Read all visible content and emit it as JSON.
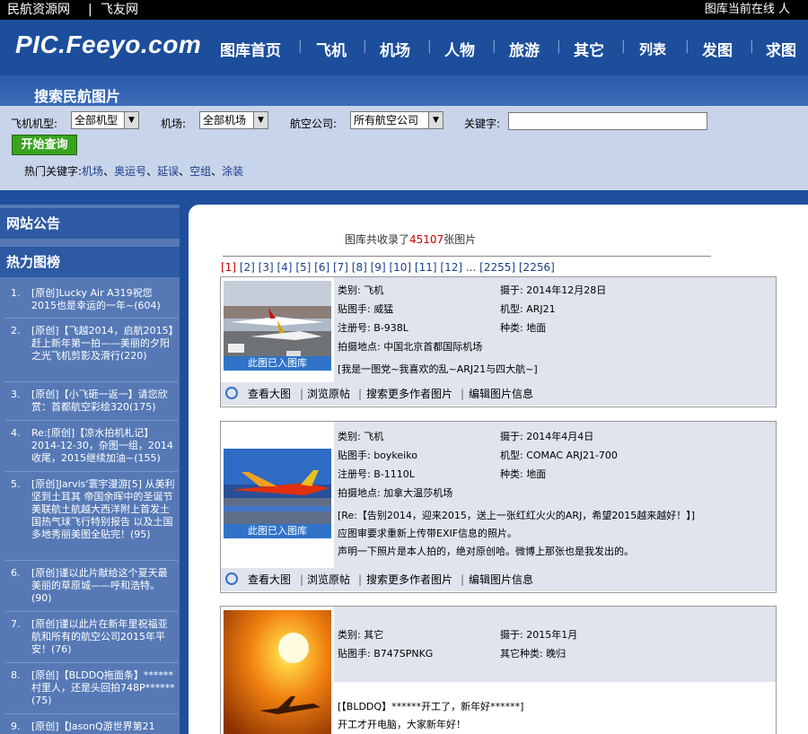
{
  "topbar": {
    "link1": "民航资源网",
    "sep": "|",
    "link2": "飞友网",
    "online": "图库当前在线 人"
  },
  "header": {
    "logo": "PIC.Feeyo.com",
    "nav": [
      "图库首页",
      "飞机",
      "机场",
      "人物",
      "旅游",
      "其它",
      "列表",
      "发图",
      "求图"
    ]
  },
  "search": {
    "title": "搜索民航图片",
    "labels": {
      "type": "飞机机型:",
      "airport": "机场:",
      "airline": "航空公司:",
      "keyword": "关键字:"
    },
    "values": {
      "type": "全部机型",
      "airport": "全部机场",
      "airline": "所有航空公司",
      "keyword": ""
    },
    "button": "开始查询",
    "hot_label": "热门关键字:",
    "hot": [
      "机场",
      "奥运号",
      "延误",
      "空组",
      "涂装"
    ]
  },
  "sidebar": {
    "notice_title": "网站公告",
    "hot_title": "热力图榜",
    "items": [
      {
        "num": "1.",
        "text": "[原创]Lucky Air A319祝您2015也是幸运的一年~(604)"
      },
      {
        "num": "2.",
        "text": "[原创]【飞越2014，启航2015】赶上新年第一拍——美丽的夕阳之光飞机剪影及滑行(220)"
      },
      {
        "num": "3.",
        "text": "[原创]【小飞砸一返一】请您欣赏：首都航空彩绘320(175)"
      },
      {
        "num": "4.",
        "text": "Re:[原创]【凉水拍机札记】2014-12-30，杂图一组，2014收尾，2015继续加油~(155)"
      },
      {
        "num": "5.",
        "text": "[原创]Jarvis'寰宇漫游[5] 从美利坚到土耳其 帝国余晖中的圣诞节 美联航土航越大西洋附上首发土国热气球飞行特别报告 以及土国多地秀丽美图全贴完！(95)"
      },
      {
        "num": "6.",
        "text": "[原创]谨以此片献给这个夏天最美丽的草原城——呼和浩特。(90)"
      },
      {
        "num": "7.",
        "text": "[原创]谨以此片在新年里祝福亚航和所有的航空公司2015年平安！(76)"
      },
      {
        "num": "8.",
        "text": "[原创]【BLDDQ拖面条】******村里人，还是头回拍748P******(75)"
      },
      {
        "num": "9.",
        "text": "[原创]【JasonQ游世界第21"
      }
    ]
  },
  "main": {
    "count_prefix": "图库共收录了",
    "count": "45107",
    "count_suffix": "张图片",
    "pager": [
      "[1]",
      "[2]",
      "[3]",
      "[4]",
      "[5]",
      "[6]",
      "[7]",
      "[8]",
      "[9]",
      "[10]",
      "[11]",
      "[12]",
      "...",
      "[2255]",
      "[2256]"
    ],
    "actions": [
      "查看大图",
      "浏览原帖",
      "搜索更多作者图片",
      "编辑图片信息"
    ],
    "stamp": "此图已入图库",
    "cards": [
      {
        "category": "类别: 飞机",
        "date": "摄于:  2014年12月28日",
        "author": "贴图手: 威猛",
        "model": "机型: ARJ21",
        "reg": "注册号: B-938L",
        "kind": "种类: 地面",
        "place": "拍摄地点: 中国北京首都国际机场",
        "desc": [
          "[我是一图党~我喜欢的乱~ARJ21与四大航~]"
        ]
      },
      {
        "category": "类别: 飞机",
        "date": "摄于:  2014年4月4日",
        "author": "贴图手: boykeiko",
        "model": "机型: COMAC ARJ21-700",
        "reg": "注册号: B-1110L",
        "kind": "种类: 地面",
        "place": "拍摄地点: 加拿大温莎机场",
        "desc": [
          "[Re:【告别2014，迎来2015，送上一张红红火火的ARJ，希望2015越来越好！】]",
          "应图审要求重新上传带EXIF信息的照片。",
          "声明一下照片是本人拍的，绝对原创哈。微博上那张也是我发出的。"
        ]
      },
      {
        "category": "类别: 其它",
        "date": "摄于:  2015年1月",
        "author": "贴图手: B747SPNKG",
        "kind": "其它种类: 晚归",
        "desc": [
          "[【BLDDQ】******开工了，新年好******]",
          "开工才开电脑，大家新年好！"
        ]
      }
    ]
  }
}
